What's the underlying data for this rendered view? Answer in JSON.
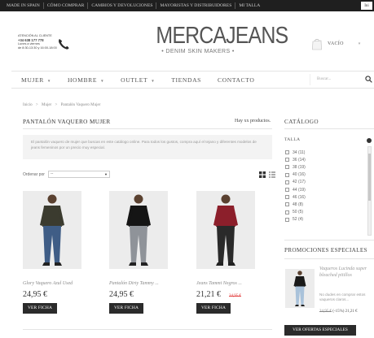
{
  "topbar": {
    "links": [
      "MADE IN SPAIN",
      "CÓMO COMPRAR",
      "CAMBIOS Y DEVOLUCIONES",
      "MAYORISTAS Y DISTRIBUIDORES",
      "MI TALLA"
    ],
    "login_label": "Ini"
  },
  "header": {
    "contact_title": "ATENCIÓN AL CLIENTE",
    "contact_phone": "+34 638 177 778",
    "contact_days": "Lunes a viernes",
    "contact_hours": "de 8:30-13:30 y 16:00-18:00",
    "brand": "MERCAJEANS",
    "tagline": "• DENIM SKIN MAKERS •",
    "cart_label": "VACÍO"
  },
  "nav": {
    "items": [
      {
        "label": "MUJER",
        "has_caret": true
      },
      {
        "label": "HOMBRE",
        "has_caret": true
      },
      {
        "label": "OUTLET",
        "has_caret": true
      },
      {
        "label": "TIENDAS",
        "has_caret": false
      },
      {
        "label": "CONTACTO",
        "has_caret": false
      }
    ],
    "caret": "▼",
    "search_placeholder": "Buscar..."
  },
  "breadcrumb": {
    "items": [
      "Inicio",
      "Mujer",
      "Pantalón Vaquero Mujer"
    ],
    "separator": ">"
  },
  "main": {
    "title": "PANTALÓN VAQUERO MUJER",
    "count_text": "Hay xx productos.",
    "description": "El pantalón vaquero de mujer que buscas en este catálogo online. Para todos los gustos, compra aquí el tejano y diferentes modelos de jeans femeninos por un precio muy especial.",
    "sort_label": "Ordenar por",
    "sort_value": "--",
    "products": [
      {
        "name": "Glory Vaquero Azul Used",
        "price": "24,95 €",
        "old_price": "",
        "button": "VER FICHA",
        "top_color": "#3b3b2f",
        "pants_color": "#3f5d86"
      },
      {
        "name": "Pantalón Dirty Tammy ...",
        "price": "24,95 €",
        "old_price": "",
        "button": "VER FICHA",
        "top_color": "#151515",
        "pants_color": "#8f9399"
      },
      {
        "name": "Jeans Tammi Negros ...",
        "price": "21,21 €",
        "old_price": "24,95 €",
        "button": "VER FICHA",
        "top_color": "#8c1f2b",
        "pants_color": "#2a2a2a"
      }
    ]
  },
  "sidebar": {
    "catalog_title": "CATÁLOGO",
    "talla_label": "TALLA",
    "sizes": [
      "34 (11)",
      "36 (14)",
      "38 (19)",
      "40 (16)",
      "42 (17)",
      "44 (19)",
      "46 (16)",
      "48 (8)",
      "50 (5)",
      "52 (4)"
    ],
    "promo_title": "PROMOCIONES ESPECIALES",
    "promo": {
      "name": "Vaqueros Lucinda super bleached pitillos",
      "desc": "No dudes en comprar estos vaqueros claros...",
      "old_price": "24,95 €",
      "discount": "(-15%)",
      "price": "21,21 €"
    },
    "promo_button": "VER OFERTAS ESPECIALES"
  },
  "colors": {
    "topbar_bg": "#1f1f1f",
    "button_bg": "#2b2b2b",
    "old_price": "#e23a3a"
  }
}
